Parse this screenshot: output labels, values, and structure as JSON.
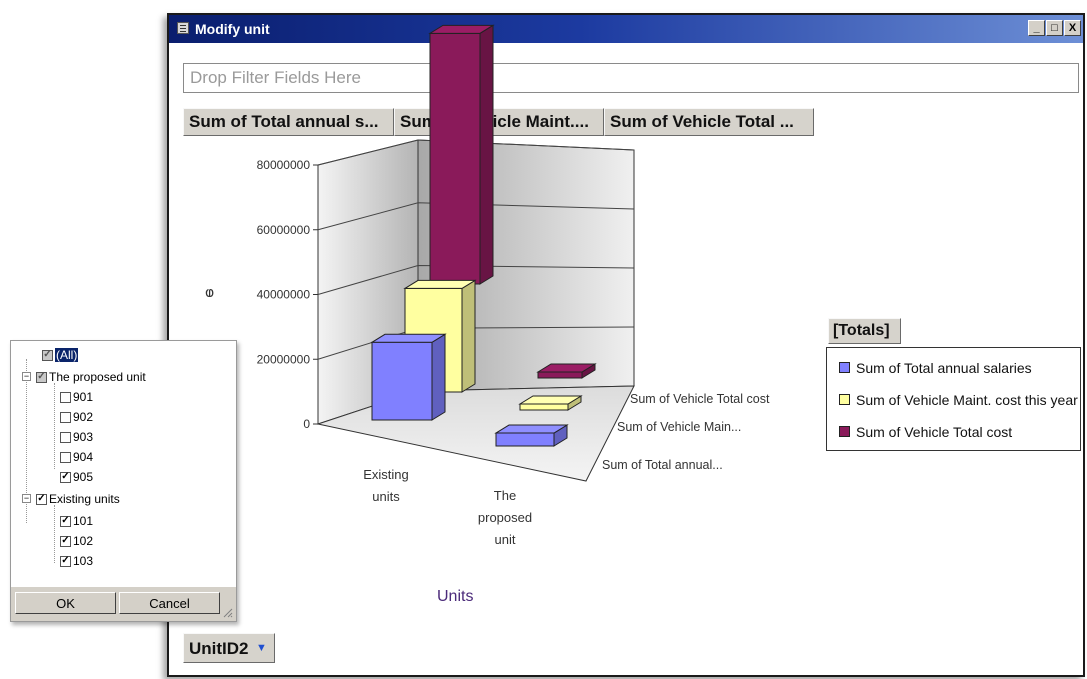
{
  "window": {
    "title": "Modify unit",
    "controls": {
      "minimize": "_",
      "maximize": "□",
      "close": "X"
    }
  },
  "filter_zone": {
    "placeholder": "Drop Filter Fields Here"
  },
  "data_fields": [
    "Sum of Total annual s...",
    "Sum of Vehicle Maint....",
    "Sum of Vehicle Total ..."
  ],
  "totals_button": "[Totals]",
  "category_field": {
    "label": "UnitID2",
    "icon": "dropdown-arrow-icon"
  },
  "chart_data": {
    "type": "bar",
    "subtype": "3d-column",
    "xlabel": "Units",
    "ylabel": "ⱷ",
    "ylim": [
      0,
      80000000
    ],
    "yticks": [
      "0",
      "20000000",
      "40000000",
      "60000000",
      "80000000"
    ],
    "categories": [
      "Existing units",
      "The proposed unit"
    ],
    "category_labels": [
      [
        "Existing",
        "units"
      ],
      [
        "The",
        "proposed",
        "unit"
      ]
    ],
    "depth_labels": [
      "Sum of Vehicle Total cost",
      "Sum of Vehicle Main...",
      "Sum of Total annual..."
    ],
    "series": [
      {
        "name": "Sum of Total annual salaries",
        "values": [
          24000000,
          4000000
        ],
        "color": "#8080ff"
      },
      {
        "name": "Sum of Vehicle Maint. cost this year",
        "values": [
          32000000,
          1500000
        ],
        "color": "#ffffa0"
      },
      {
        "name": "Sum of Vehicle Total cost",
        "values": [
          79000000,
          1000000
        ],
        "color": "#8a1a5a"
      }
    ],
    "grid": true,
    "legend": "right"
  },
  "filter_panel": {
    "all_label": "(All)",
    "groups": [
      {
        "label": "The proposed unit",
        "expander": "−",
        "items": [
          {
            "label": "901",
            "checked": false
          },
          {
            "label": "902",
            "checked": false
          },
          {
            "label": "903",
            "checked": false
          },
          {
            "label": "904",
            "checked": false
          },
          {
            "label": "905",
            "checked": true
          }
        ]
      },
      {
        "label": "Existing units",
        "expander": "−",
        "items": [
          {
            "label": "101",
            "checked": true
          },
          {
            "label": "102",
            "checked": true
          },
          {
            "label": "103",
            "checked": true
          }
        ]
      }
    ],
    "ok_label": "OK",
    "cancel_label": "Cancel"
  }
}
